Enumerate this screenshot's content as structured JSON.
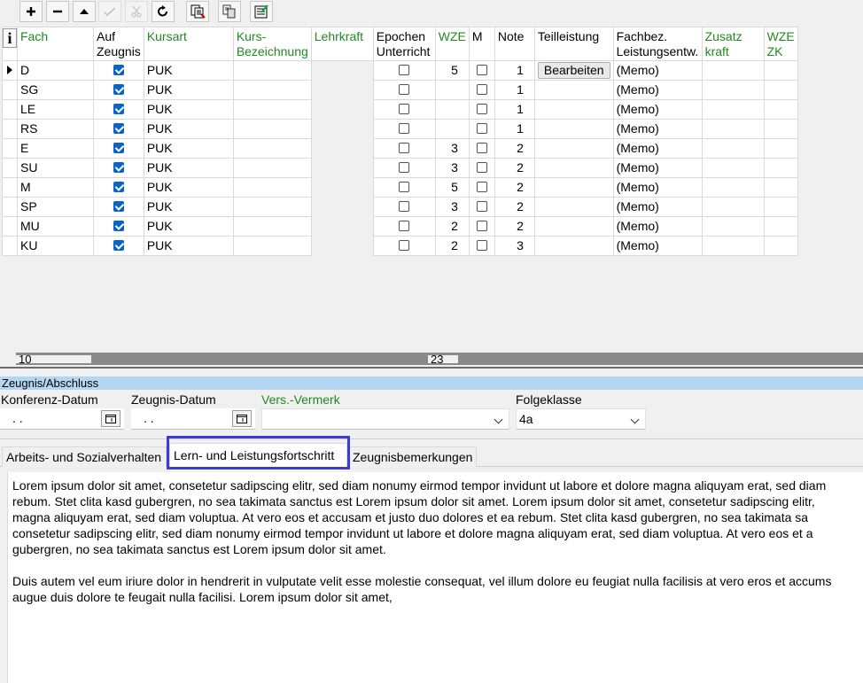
{
  "toolbar": {
    "buttons": [
      {
        "name": "add-button",
        "glyph": "+"
      },
      {
        "name": "remove-button",
        "glyph": "−"
      },
      {
        "name": "move-up-button",
        "glyph": "▲"
      },
      {
        "name": "check-button",
        "glyph": "✓"
      },
      {
        "name": "cut-button",
        "glyph": "✂"
      },
      {
        "name": "redo-button",
        "glyph": "↻"
      }
    ]
  },
  "grid": {
    "columns": [
      "Fach",
      "Auf Zeugnis",
      "Kursart",
      "Kurs-Bezeichnung",
      "Lehrkraft",
      "Epochen Unterricht",
      "WZE",
      "M",
      "Note",
      "Teilleistung",
      "Fachbez. Leistungsentw.",
      "Zusatz kraft",
      "WZE ZK"
    ],
    "edit_label": "Bearbeiten",
    "rows": [
      {
        "fach": "D",
        "auf_zeugnis": true,
        "kursart": "PUK",
        "epochen": false,
        "wze": "5",
        "m": false,
        "note": "1",
        "memo": "(Memo)"
      },
      {
        "fach": "SG",
        "auf_zeugnis": true,
        "kursart": "PUK",
        "epochen": false,
        "wze": "",
        "m": false,
        "note": "1",
        "memo": "(Memo)"
      },
      {
        "fach": "LE",
        "auf_zeugnis": true,
        "kursart": "PUK",
        "epochen": false,
        "wze": "",
        "m": false,
        "note": "1",
        "memo": "(Memo)"
      },
      {
        "fach": "RS",
        "auf_zeugnis": true,
        "kursart": "PUK",
        "epochen": false,
        "wze": "",
        "m": false,
        "note": "1",
        "memo": "(Memo)"
      },
      {
        "fach": "E",
        "auf_zeugnis": true,
        "kursart": "PUK",
        "epochen": false,
        "wze": "3",
        "m": false,
        "note": "2",
        "memo": "(Memo)"
      },
      {
        "fach": "SU",
        "auf_zeugnis": true,
        "kursart": "PUK",
        "epochen": false,
        "wze": "3",
        "m": false,
        "note": "2",
        "memo": "(Memo)"
      },
      {
        "fach": "M",
        "auf_zeugnis": true,
        "kursart": "PUK",
        "epochen": false,
        "wze": "5",
        "m": false,
        "note": "2",
        "memo": "(Memo)"
      },
      {
        "fach": "SP",
        "auf_zeugnis": true,
        "kursart": "PUK",
        "epochen": false,
        "wze": "3",
        "m": false,
        "note": "2",
        "memo": "(Memo)"
      },
      {
        "fach": "MU",
        "auf_zeugnis": true,
        "kursart": "PUK",
        "epochen": false,
        "wze": "2",
        "m": false,
        "note": "2",
        "memo": "(Memo)"
      },
      {
        "fach": "KU",
        "auf_zeugnis": true,
        "kursart": "PUK",
        "epochen": false,
        "wze": "2",
        "m": false,
        "note": "3",
        "memo": "(Memo)"
      }
    ]
  },
  "scroll": {
    "left_value": "10",
    "mid_value": "23"
  },
  "zeugnis": {
    "section_title": "Zeugnis/Abschluss",
    "konferenz_label": "Konferenz-Datum",
    "konferenz_value": ". .",
    "zeugnis_label": "Zeugnis-Datum",
    "zeugnis_value": ". .",
    "vermerk_label": "Vers.-Vermerk",
    "vermerk_value": "",
    "folgeklasse_label": "Folgeklasse",
    "folgeklasse_value": "4a"
  },
  "tabs": [
    {
      "label": "Arbeits- und Sozialverhalten",
      "active": false
    },
    {
      "label": "Lern- und Leistungsfortschritt",
      "active": true
    },
    {
      "label": "Zeugnisbemerkungen",
      "active": false
    }
  ],
  "memo_text": "Lorem ipsum dolor sit amet, consetetur sadipscing elitr, sed diam nonumy eirmod tempor invidunt ut labore et dolore magna aliquyam erat, sed diam\nrebum. Stet clita kasd gubergren, no sea takimata sanctus est Lorem ipsum dolor sit amet. Lorem ipsum dolor sit amet, consetetur sadipscing elitr,\nmagna aliquyam erat, sed diam voluptua. At vero eos et accusam et justo duo dolores et ea rebum. Stet clita kasd gubergren, no sea takimata sa\nconsetetur sadipscing elitr, sed diam nonumy eirmod tempor invidunt ut labore et dolore magna aliquyam erat, sed diam voluptua. At vero eos et a\ngubergren, no sea takimata sanctus est Lorem ipsum dolor sit amet.\n\nDuis autem vel eum iriure dolor in hendrerit in vulputate velit esse molestie consequat, vel illum dolore eu feugiat nulla facilisis at vero eros et accums\naugue duis dolore te feugait nulla facilisi. Lorem ipsum dolor sit amet,",
  "colors": {
    "accent_green": "#1f8a1f",
    "section_blue": "#b3d7f3",
    "highlight": "#3c3ccf",
    "checkbox_blue": "#0a64c8"
  }
}
